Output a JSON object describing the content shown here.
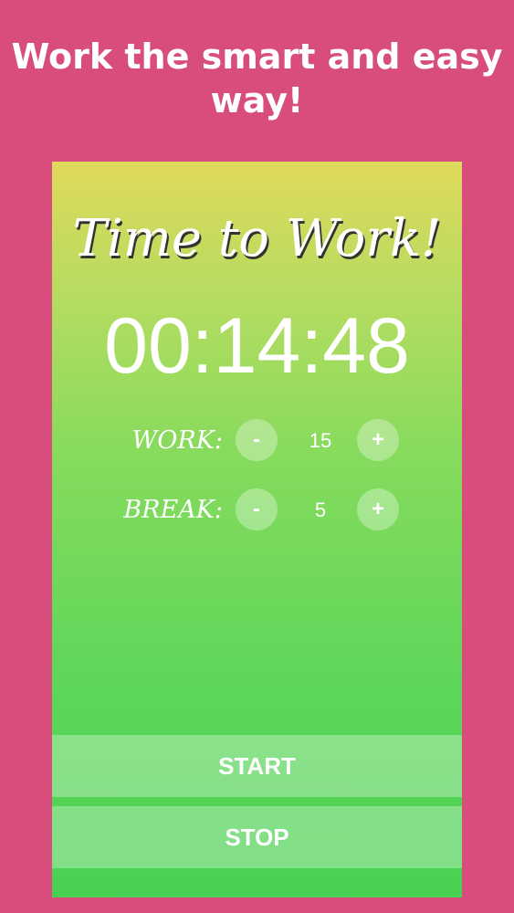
{
  "promo": {
    "line1": "Work the smart and easy",
    "line2": "way!"
  },
  "screen": {
    "headline": "Time to Work!",
    "timer": "00:14:48",
    "settings": [
      {
        "label": "WORK:",
        "value": "15",
        "minus": "-",
        "plus": "+"
      },
      {
        "label": "BREAK:",
        "value": "5",
        "minus": "-",
        "plus": "+"
      }
    ],
    "actions": {
      "start": "START",
      "stop": "STOP"
    }
  },
  "colors": {
    "background": "#d84d7b",
    "gradient_top": "#e0d95c",
    "gradient_bottom": "#48d152",
    "text": "#ffffff"
  }
}
